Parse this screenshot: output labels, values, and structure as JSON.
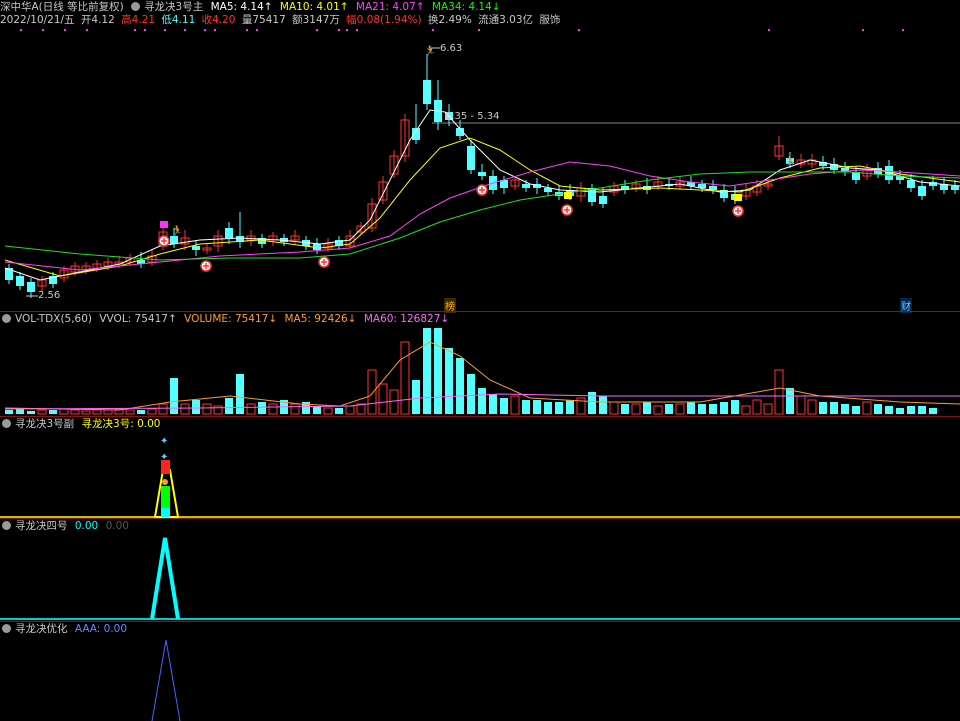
{
  "header": {
    "stock_name": "深中华A(日线 等比前复权)",
    "indicator_name": "寻龙决3号主",
    "ma5": "MA5: 4.14↑",
    "ma10": "MA10: 4.01↑",
    "ma21": "MA21: 4.07↑",
    "ma34": "MA34: 4.14↓",
    "date": "2022/10/21/五",
    "open": "开4.12",
    "high": "高4.21",
    "low": "低4.11",
    "close": "收4.20",
    "volume": "量75417",
    "amount": "额3147万",
    "change": "幅0.08(1.94%)",
    "turnover": "换2.49%",
    "float_cap": "流通3.03亿",
    "industry": "服饰"
  },
  "main_chart": {
    "high_label": "6.63",
    "low_label": "2.56",
    "range_label": "5.35 - 5.34",
    "marker_left": "榜",
    "marker_right": "财"
  },
  "vol_panel": {
    "name": "VOL-TDX(5,60)",
    "vvol": "VVOL: 75417↑",
    "volume": "VOLUME: 75417↓",
    "ma5": "MA5: 92426↓",
    "ma60": "MA60: 126827↓"
  },
  "panel3": {
    "name": "寻龙决3号副",
    "value": "寻龙决3号: 0.00"
  },
  "panel4": {
    "name": "寻龙决四号",
    "value": "0.00",
    "value2": "0.00"
  },
  "panel5": {
    "name": "寻龙决优化",
    "value": "AAA: 0.00"
  },
  "colors": {
    "up": "#ff3232",
    "down": "#54ffff",
    "ma5": "#ffffff",
    "ma10": "#ffff00",
    "ma21": "#ff00ff",
    "ma34": "#00ff00"
  }
}
